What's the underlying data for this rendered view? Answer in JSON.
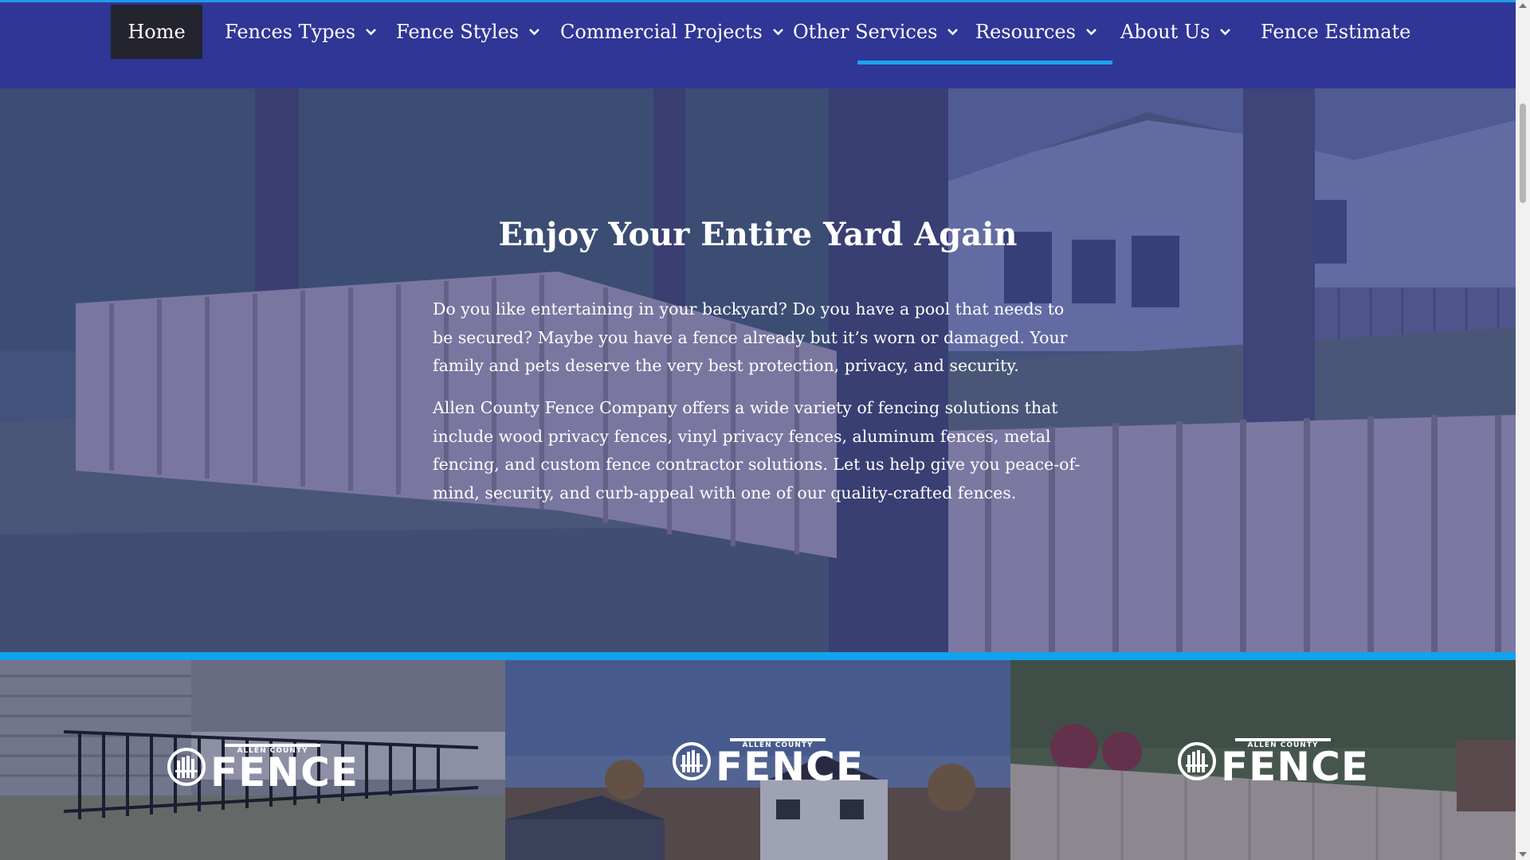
{
  "nav": {
    "items": [
      {
        "label": "Home",
        "active": true,
        "dropdown": false
      },
      {
        "label": "Fences Types",
        "active": false,
        "dropdown": true
      },
      {
        "label": "Fence Styles",
        "active": false,
        "dropdown": true
      },
      {
        "label": "Commercial Projects",
        "active": false,
        "dropdown": true
      },
      {
        "label": "Other Services",
        "active": false,
        "dropdown": true
      },
      {
        "label": "Resources",
        "active": false,
        "dropdown": true
      },
      {
        "label": "About Us",
        "active": false,
        "dropdown": true
      },
      {
        "label": "Fence Estimate",
        "active": false,
        "dropdown": false
      }
    ],
    "underline_item": "Resources"
  },
  "hero": {
    "title": "Enjoy Your Entire Yard Again",
    "paragraph1": "Do you like entertaining in your backyard? Do you have a pool that needs to be secured? Maybe you have a fence already but it’s worn or damaged. Your family and pets deserve the very best protection, privacy, and security.",
    "paragraph2": "Allen County Fence Company offers a wide variety of fencing solutions that include wood privacy fences, vinyl privacy fences, aluminum fences, metal fencing, and custom fence contractor solutions. Let us help give you peace-of-mind, security, and curb-appeal with one of our quality-crafted fences."
  },
  "tiles": [
    {
      "logo_small": "ALLEN COUNTY",
      "logo_big": "FENCE"
    },
    {
      "logo_small": "ALLEN COUNTY",
      "logo_big": "FENCE"
    },
    {
      "logo_small": "ALLEN COUNTY",
      "logo_big": "FENCE"
    }
  ],
  "colors": {
    "nav_bg": "#2f3696",
    "accent_blue": "#11a3ec",
    "active_tab_bg": "#23242e"
  },
  "icons": {
    "dropdown": "chevron-down-icon",
    "logo": "fence-logo-icon"
  }
}
